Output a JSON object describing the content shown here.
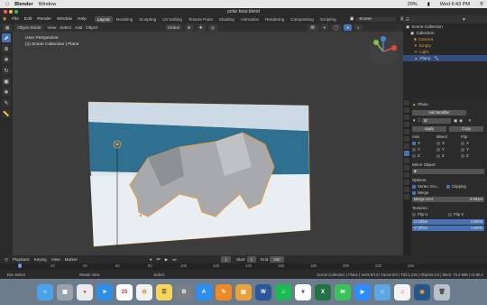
{
  "mac_menubar": {
    "app": "Blender",
    "menu": "Window",
    "battery": "29%",
    "datetime": "Wed 6:43 PM"
  },
  "window_title": "polar bear.blend",
  "menu": [
    "File",
    "Edit",
    "Render",
    "Window",
    "Help"
  ],
  "workspaces": [
    "Layout",
    "Modeling",
    "Sculpting",
    "UV Editing",
    "Texture Paint",
    "Shading",
    "Animation",
    "Rendering",
    "Compositing",
    "Scripting"
  ],
  "scene": "Scene",
  "view_layer": "View Layer",
  "viewport_header": {
    "mode": "Object Mode",
    "menus": [
      "View",
      "Select",
      "Add",
      "Object"
    ],
    "orientation": "Global"
  },
  "viewport": {
    "perspective": "User Perspective",
    "collection": "(1) Scene Collection | Plane"
  },
  "outliner": {
    "root": "Scene Collection",
    "items": [
      {
        "label": "Collection",
        "selected": false
      },
      {
        "label": "Camera",
        "selected": false
      },
      {
        "label": "Empty",
        "selected": false
      },
      {
        "label": "Light",
        "selected": false
      },
      {
        "label": "Plane",
        "selected": true
      }
    ]
  },
  "properties": {
    "object": "Plane",
    "add_modifier": "Add Modifier",
    "modifier_letter": "M",
    "apply": "Apply",
    "copy": "Copy",
    "axis_label": "Axis",
    "bisect_label": "Bisect",
    "flip_label": "Flip",
    "axes": [
      "X",
      "Y",
      "Z"
    ],
    "mirror_object": "Mirror Object:",
    "options": "Options:",
    "vertex_groups": "Vertex Gro...",
    "clipping": "Clipping",
    "merge": "Merge",
    "merge_limit": "Merge Limi:",
    "merge_value": "0.001m",
    "textures": "Textures:",
    "flip_u": "Flip U",
    "flip_v": "Flip V",
    "u_offset": "U Offset",
    "v_offset": "V Offset",
    "u_value": "0.0000",
    "v_value": "0.0000"
  },
  "timeline": {
    "menus": [
      "Playback",
      "Keying",
      "View",
      "Marker"
    ],
    "current_frame": "1",
    "start_label": "Start",
    "start": "1",
    "end_label": "End",
    "end": "250",
    "ticks": [
      "0",
      "20",
      "40",
      "60",
      "80",
      "100",
      "120",
      "140",
      "160",
      "180",
      "200",
      "220",
      "240"
    ]
  },
  "status_bar": {
    "left": "Box Select",
    "middle": "Rotate View",
    "select": "Select",
    "right": "Scene Collection | Plane | Verts:9/13 | Faces:0/3 | Tris:1,218 | Objects:1/4 | Mem: 74.2 MiB | v2.90.1"
  },
  "dock_apps": [
    "Finder",
    "Launchpad",
    "Chrome",
    "Safari",
    "Calendar",
    "Photos",
    "Notes",
    "Preferences",
    "App Store",
    "Pages",
    "Files",
    "Word",
    "Spotify",
    "Slack",
    "Excel",
    "Messages",
    "Zoom",
    "Finder2",
    "iTunes",
    "Blender",
    "Trash"
  ],
  "colors": {
    "accent": "#4772b3",
    "selection": "#334d80",
    "orange": "#e59a3a"
  }
}
